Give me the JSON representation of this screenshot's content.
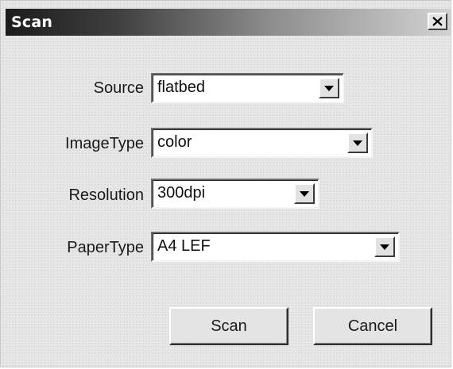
{
  "window": {
    "title": "Scan",
    "close_icon": "close-icon"
  },
  "form": {
    "source": {
      "label": "Source",
      "value": "flatbed"
    },
    "image_type": {
      "label": "ImageType",
      "value": "color"
    },
    "resolution": {
      "label": "Resolution",
      "value": "300dpi"
    },
    "paper_type": {
      "label": "PaperType",
      "value": "A4 LEF"
    }
  },
  "buttons": {
    "scan_label": "Scan",
    "cancel_label": "Cancel"
  },
  "icons": {
    "dropdown": "chevron-down-icon"
  }
}
